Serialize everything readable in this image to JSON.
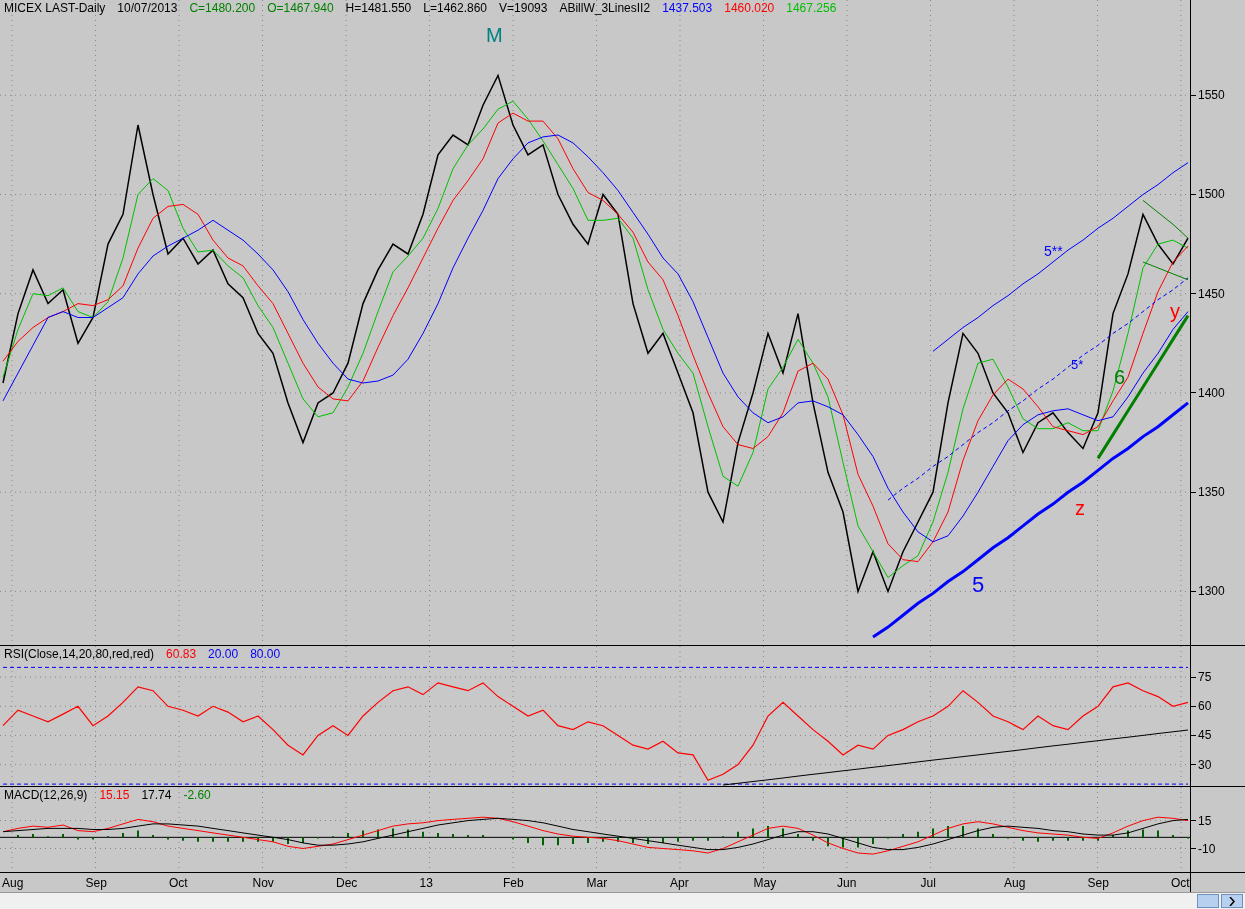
{
  "price_chart": {
    "header": [
      {
        "text": "MICEX LAST-Daily",
        "color": "#000000"
      },
      {
        "text": "10/07/2013",
        "color": "#000000"
      },
      {
        "text": "C=1480.200",
        "color": "#008000"
      },
      {
        "text": "O=1467.940",
        "color": "#008000"
      },
      {
        "text": "H=1481.550",
        "color": "#000000"
      },
      {
        "text": "L=1462.860",
        "color": "#000000"
      },
      {
        "text": "V=19093",
        "color": "#000000"
      },
      {
        "text": "ABillW_3LinesII2",
        "color": "#000000"
      },
      {
        "text": "1437.503",
        "color": "#0000ff"
      },
      {
        "text": "1460.020",
        "color": "#ff0000"
      },
      {
        "text": "1467.256",
        "color": "#00c000"
      }
    ],
    "labels": [
      {
        "text": "M",
        "color": "#008080"
      },
      {
        "text": "5**",
        "color": "#0000ff"
      },
      {
        "text": "5*",
        "color": "#0000ff"
      },
      {
        "text": "5",
        "color": "#0000ff"
      },
      {
        "text": "z",
        "color": "#ff0000"
      },
      {
        "text": "y",
        "color": "#ff0000"
      },
      {
        "text": "6",
        "color": "#008000"
      }
    ],
    "chart_data": {
      "type": "line",
      "grid": true,
      "ylim": [
        1273,
        1598
      ],
      "yticks": [
        {
          "value": 1550,
          "label": "1550"
        },
        {
          "value": 1500,
          "label": "1500"
        },
        {
          "value": 1450,
          "label": "1450"
        },
        {
          "value": 1400,
          "label": "1400"
        },
        {
          "value": 1350,
          "label": "1350"
        },
        {
          "value": 1300,
          "label": "1300"
        }
      ],
      "series": [
        {
          "color": "#000000",
          "values": [
            1405,
            1440,
            1462,
            1445,
            1452,
            1425,
            1438,
            1475,
            1490,
            1535,
            1500,
            1470,
            1478,
            1465,
            1472,
            1455,
            1448,
            1430,
            1420,
            1395,
            1375,
            1395,
            1400,
            1415,
            1445,
            1462,
            1475,
            1470,
            1490,
            1520,
            1530,
            1525,
            1545,
            1560,
            1535,
            1520,
            1525,
            1500,
            1485,
            1475,
            1500,
            1490,
            1445,
            1420,
            1430,
            1410,
            1390,
            1350,
            1335,
            1375,
            1400,
            1430,
            1410,
            1440,
            1395,
            1360,
            1340,
            1300,
            1320,
            1300,
            1320,
            1335,
            1350,
            1395,
            1430,
            1420,
            1400,
            1390,
            1370,
            1385,
            1390,
            1380,
            1372,
            1390,
            1440,
            1460,
            1490,
            1475,
            1465,
            1478
          ]
        },
        {
          "color": "#00c000",
          "values": [
            1408,
            1432,
            1450,
            1449,
            1453,
            1441,
            1438,
            1446,
            1468,
            1500,
            1508,
            1502,
            1483,
            1471,
            1472,
            1464,
            1458,
            1444,
            1433,
            1415,
            1397,
            1388,
            1390,
            1403,
            1420,
            1441,
            1461,
            1469,
            1478,
            1493,
            1513,
            1525,
            1533,
            1543,
            1547,
            1538,
            1527,
            1515,
            1503,
            1487,
            1487,
            1488,
            1478,
            1452,
            1432,
            1420,
            1410,
            1383,
            1358,
            1353,
            1370,
            1402,
            1413,
            1427,
            1415,
            1398,
            1365,
            1333,
            1320,
            1307,
            1313,
            1318,
            1335,
            1360,
            1392,
            1415,
            1417,
            1403,
            1387,
            1382,
            1382,
            1385,
            1381,
            1381,
            1401,
            1430,
            1463,
            1475,
            1477,
            1473
          ]
        },
        {
          "color": "#ff0000",
          "values": [
            1416,
            1426,
            1433,
            1438,
            1441,
            1445,
            1444,
            1447,
            1454,
            1473,
            1488,
            1494,
            1495,
            1490,
            1477,
            1468,
            1464,
            1454,
            1445,
            1430,
            1415,
            1403,
            1397,
            1396,
            1406,
            1423,
            1439,
            1453,
            1468,
            1483,
            1497,
            1507,
            1518,
            1536,
            1541,
            1537,
            1537,
            1528,
            1513,
            1501,
            1497,
            1490,
            1481,
            1466,
            1457,
            1439,
            1419,
            1400,
            1383,
            1374,
            1372,
            1378,
            1390,
            1411,
            1415,
            1407,
            1389,
            1359,
            1343,
            1324,
            1316,
            1315,
            1325,
            1340,
            1366,
            1386,
            1399,
            1407,
            1402,
            1393,
            1383,
            1381,
            1379,
            1383,
            1396,
            1408,
            1430,
            1451,
            1466,
            1474
          ]
        },
        {
          "color": "#0000ff",
          "values": [
            1396,
            1410,
            1424,
            1438,
            1441,
            1438,
            1438,
            1443,
            1448,
            1460,
            1469,
            1474,
            1478,
            1482,
            1487,
            1482,
            1477,
            1470,
            1462,
            1451,
            1437,
            1425,
            1415,
            1407,
            1405,
            1406,
            1409,
            1417,
            1430,
            1445,
            1463,
            1478,
            1492,
            1508,
            1518,
            1526,
            1529,
            1530,
            1526,
            1519,
            1511,
            1502,
            1491,
            1480,
            1468,
            1460,
            1446,
            1428,
            1410,
            1398,
            1390,
            1385,
            1388,
            1395,
            1396,
            1393,
            1389,
            1379,
            1368,
            1352,
            1340,
            1330,
            1325,
            1328,
            1338,
            1350,
            1363,
            1376,
            1384,
            1389,
            1391,
            1392,
            1389,
            1386,
            1388,
            1398,
            1410,
            1420,
            1432,
            1441
          ]
        },
        {
          "color": "#0000ff",
          "values": [
            null,
            null,
            null,
            null,
            null,
            null,
            null,
            null,
            null,
            null,
            null,
            null,
            null,
            null,
            null,
            null,
            null,
            null,
            null,
            null,
            null,
            null,
            null,
            null,
            null,
            null,
            null,
            null,
            null,
            null,
            null,
            null,
            null,
            null,
            null,
            null,
            null,
            null,
            null,
            null,
            null,
            null,
            null,
            null,
            null,
            null,
            null,
            null,
            null,
            null,
            null,
            null,
            null,
            null,
            null,
            null,
            null,
            null,
            1277,
            1282,
            1288,
            1294,
            1299,
            1305,
            1310,
            1316,
            1322,
            1327,
            1333,
            1339,
            1344,
            1350,
            1355,
            1361,
            1367,
            1372,
            1378,
            1383,
            1389,
            1395
          ]
        },
        {
          "color": "#0000ff",
          "values": [
            null,
            null,
            null,
            null,
            null,
            null,
            null,
            null,
            null,
            null,
            null,
            null,
            null,
            null,
            null,
            null,
            null,
            null,
            null,
            null,
            null,
            null,
            null,
            null,
            null,
            null,
            null,
            null,
            null,
            null,
            null,
            null,
            null,
            null,
            null,
            null,
            null,
            null,
            null,
            null,
            null,
            null,
            null,
            null,
            null,
            null,
            null,
            null,
            null,
            null,
            null,
            null,
            null,
            null,
            null,
            null,
            null,
            null,
            null,
            null,
            null,
            null,
            1421,
            1427,
            1433,
            1438,
            1444,
            1449,
            1455,
            1460,
            1466,
            1472,
            1477,
            1483,
            1488,
            1494,
            1500,
            1505,
            1511,
            1516
          ]
        },
        {
          "color": "#0000ff",
          "line_style": "dashed",
          "values": [
            null,
            null,
            null,
            null,
            null,
            null,
            null,
            null,
            null,
            null,
            null,
            null,
            null,
            null,
            null,
            null,
            null,
            null,
            null,
            null,
            null,
            null,
            null,
            null,
            null,
            null,
            null,
            null,
            null,
            null,
            null,
            null,
            null,
            null,
            null,
            null,
            null,
            null,
            null,
            null,
            null,
            null,
            null,
            null,
            null,
            null,
            null,
            null,
            null,
            null,
            null,
            null,
            null,
            null,
            null,
            null,
            null,
            null,
            null,
            1346,
            1352,
            1357,
            1363,
            1368,
            1374,
            1380,
            1385,
            1391,
            1396,
            1402,
            1407,
            1413,
            1419,
            1424,
            1430,
            1435,
            1441,
            1447,
            1452,
            1458
          ]
        },
        {
          "color": "#008000",
          "values": [
            null,
            null,
            null,
            null,
            null,
            null,
            null,
            null,
            null,
            null,
            null,
            null,
            null,
            null,
            null,
            null,
            null,
            null,
            null,
            null,
            null,
            null,
            null,
            null,
            null,
            null,
            null,
            null,
            null,
            null,
            null,
            null,
            null,
            null,
            null,
            null,
            null,
            null,
            null,
            null,
            null,
            null,
            null,
            null,
            null,
            null,
            null,
            null,
            null,
            null,
            null,
            null,
            null,
            null,
            null,
            null,
            null,
            null,
            null,
            null,
            null,
            null,
            null,
            null,
            null,
            null,
            null,
            null,
            null,
            null,
            null,
            null,
            null,
            1367,
            1379,
            1391,
            1403,
            1415,
            1427,
            1439
          ]
        },
        {
          "color": "#008000",
          "values": [
            null,
            null,
            null,
            null,
            null,
            null,
            null,
            null,
            null,
            null,
            null,
            null,
            null,
            null,
            null,
            null,
            null,
            null,
            null,
            null,
            null,
            null,
            null,
            null,
            null,
            null,
            null,
            null,
            null,
            null,
            null,
            null,
            null,
            null,
            null,
            null,
            null,
            null,
            null,
            null,
            null,
            null,
            null,
            null,
            null,
            null,
            null,
            null,
            null,
            null,
            null,
            null,
            null,
            null,
            null,
            null,
            null,
            null,
            null,
            null,
            null,
            null,
            null,
            null,
            null,
            null,
            null,
            null,
            null,
            null,
            null,
            null,
            null,
            null,
            null,
            null,
            1497,
            1491,
            1485,
            1478
          ]
        },
        {
          "color": "#008000",
          "values": [
            null,
            null,
            null,
            null,
            null,
            null,
            null,
            null,
            null,
            null,
            null,
            null,
            null,
            null,
            null,
            null,
            null,
            null,
            null,
            null,
            null,
            null,
            null,
            null,
            null,
            null,
            null,
            null,
            null,
            null,
            null,
            null,
            null,
            null,
            null,
            null,
            null,
            null,
            null,
            null,
            null,
            null,
            null,
            null,
            null,
            null,
            null,
            null,
            null,
            null,
            null,
            null,
            null,
            null,
            null,
            null,
            null,
            null,
            null,
            null,
            null,
            null,
            null,
            null,
            null,
            null,
            null,
            null,
            null,
            null,
            null,
            null,
            null,
            null,
            null,
            null,
            1466,
            1463,
            1460,
            1457
          ]
        }
      ]
    }
  },
  "rsi": {
    "header": [
      {
        "text": "RSI(Close,14,20,80,red,red)",
        "color": "#000000"
      },
      {
        "text": "60.83",
        "color": "#ff0000"
      },
      {
        "text": "20.00",
        "color": "#0000ff"
      },
      {
        "text": "80.00",
        "color": "#0000ff"
      }
    ],
    "chart_data": {
      "type": "line",
      "grid": true,
      "ylim": [
        19,
        91
      ],
      "yticks": [
        {
          "value": 75,
          "label": "75"
        },
        {
          "value": 60,
          "label": "60"
        },
        {
          "value": 45,
          "label": "45"
        },
        {
          "value": 30,
          "label": "30"
        }
      ],
      "series": [
        {
          "color": "#ff0000",
          "values": [
            50,
            58,
            55,
            52,
            56,
            60,
            50,
            55,
            62,
            70,
            68,
            60,
            58,
            55,
            60,
            57,
            52,
            55,
            48,
            40,
            35,
            45,
            50,
            45,
            55,
            62,
            68,
            70,
            66,
            72,
            70,
            68,
            72,
            65,
            60,
            55,
            58,
            50,
            48,
            52,
            50,
            45,
            40,
            38,
            42,
            36,
            35,
            22,
            25,
            30,
            40,
            55,
            62,
            55,
            48,
            42,
            35,
            40,
            38,
            45,
            48,
            52,
            55,
            60,
            68,
            62,
            55,
            52,
            48,
            55,
            50,
            48,
            55,
            60,
            70,
            72,
            68,
            65,
            60,
            62
          ]
        },
        {
          "color": "#0000ff",
          "line_style": "dashed",
          "values": [
            80,
            80,
            80,
            80,
            80,
            80,
            80,
            80,
            80,
            80,
            80,
            80,
            80,
            80,
            80,
            80,
            80,
            80,
            80,
            80,
            80,
            80,
            80,
            80,
            80,
            80,
            80,
            80,
            80,
            80,
            80,
            80,
            80,
            80,
            80,
            80,
            80,
            80,
            80,
            80,
            80,
            80,
            80,
            80,
            80,
            80,
            80,
            80,
            80,
            80,
            80,
            80,
            80,
            80,
            80,
            80,
            80,
            80,
            80,
            80,
            80,
            80,
            80,
            80,
            80,
            80,
            80,
            80,
            80,
            80,
            80,
            80,
            80,
            80,
            80,
            80,
            80,
            80,
            80,
            80
          ]
        },
        {
          "color": "#0000ff",
          "line_style": "dashed",
          "values": [
            20,
            20,
            20,
            20,
            20,
            20,
            20,
            20,
            20,
            20,
            20,
            20,
            20,
            20,
            20,
            20,
            20,
            20,
            20,
            20,
            20,
            20,
            20,
            20,
            20,
            20,
            20,
            20,
            20,
            20,
            20,
            20,
            20,
            20,
            20,
            20,
            20,
            20,
            20,
            20,
            20,
            20,
            20,
            20,
            20,
            20,
            20,
            20,
            20,
            20,
            20,
            20,
            20,
            20,
            20,
            20,
            20,
            20,
            20,
            20,
            20,
            20,
            20,
            20,
            20,
            20,
            20,
            20,
            20,
            20,
            20,
            20,
            20,
            20,
            20,
            20,
            20,
            20,
            20,
            20
          ]
        },
        {
          "color": "#000000",
          "values": [
            null,
            null,
            null,
            null,
            null,
            null,
            null,
            null,
            null,
            null,
            null,
            null,
            null,
            null,
            null,
            null,
            null,
            null,
            null,
            null,
            null,
            null,
            null,
            null,
            null,
            null,
            null,
            null,
            null,
            null,
            null,
            null,
            null,
            null,
            null,
            null,
            null,
            null,
            null,
            null,
            null,
            null,
            null,
            null,
            null,
            null,
            null,
            null,
            19.5,
            20.4,
            21.3,
            22.2,
            23.1,
            24.1,
            25.0,
            25.9,
            26.8,
            27.7,
            28.6,
            29.5,
            30.4,
            31.4,
            32.3,
            33.2,
            34.1,
            35.0,
            35.9,
            36.8,
            37.7,
            38.7,
            39.6,
            40.5,
            41.4,
            42.3,
            43.2,
            44.1,
            45.0,
            46.0,
            46.9,
            47.8
          ]
        }
      ]
    }
  },
  "macd": {
    "header": [
      {
        "text": "MACD(12,26,9)",
        "color": "#000000"
      },
      {
        "text": "15.15",
        "color": "#ff0000"
      },
      {
        "text": "17.74",
        "color": "#000000"
      },
      {
        "text": "-2.60",
        "color": "#008000"
      }
    ],
    "chart_data": {
      "type": "line",
      "grid": true,
      "ylim": [
        -31,
        45
      ],
      "yticks": [
        {
          "value": 15,
          "label": "15"
        },
        {
          "value": -10,
          "label": "-10"
        }
      ],
      "series": [
        {
          "color": "#ff0000",
          "values": [
            5,
            8,
            10,
            9,
            11,
            6,
            5,
            8,
            12,
            16,
            14,
            10,
            8,
            6,
            4,
            2,
            0,
            -2,
            -4,
            -8,
            -10,
            -8,
            -6,
            -2,
            2,
            6,
            10,
            12,
            13,
            15,
            16,
            17,
            18,
            17,
            14,
            10,
            6,
            3,
            1,
            0,
            -1,
            -3,
            -6,
            -9,
            -10,
            -11,
            -12,
            -14,
            -10,
            -4,
            2,
            8,
            10,
            8,
            2,
            -5,
            -10,
            -14,
            -15,
            -12,
            -8,
            -4,
            2,
            8,
            12,
            14,
            12,
            9,
            6,
            4,
            3,
            2,
            0,
            -1,
            4,
            10,
            15,
            18,
            17,
            15
          ]
        },
        {
          "color": "#000000",
          "values": [
            5,
            6,
            7,
            8,
            8,
            8,
            7,
            7,
            8,
            10,
            12,
            12,
            11,
            10,
            8,
            6,
            4,
            2,
            0,
            -2,
            -5,
            -7,
            -7,
            -6,
            -4,
            -1,
            2,
            5,
            8,
            11,
            13,
            15,
            16,
            17,
            16,
            15,
            13,
            10,
            7,
            5,
            3,
            1,
            -1,
            -3,
            -5,
            -7,
            -9,
            -11,
            -11,
            -9,
            -6,
            -2,
            2,
            5,
            5,
            3,
            -1,
            -5,
            -9,
            -11,
            -11,
            -9,
            -6,
            -2,
            2,
            6,
            9,
            10,
            9,
            8,
            6,
            5,
            3,
            2,
            2,
            4,
            8,
            12,
            15,
            16
          ]
        }
      ]
    }
  },
  "date_axis": [
    "Aug",
    "Sep",
    "Oct",
    "Nov",
    "Dec",
    "13",
    "Feb",
    "Mar",
    "Apr",
    "May",
    "Jun",
    "Jul",
    "Aug",
    "Sep",
    "Oct"
  ]
}
